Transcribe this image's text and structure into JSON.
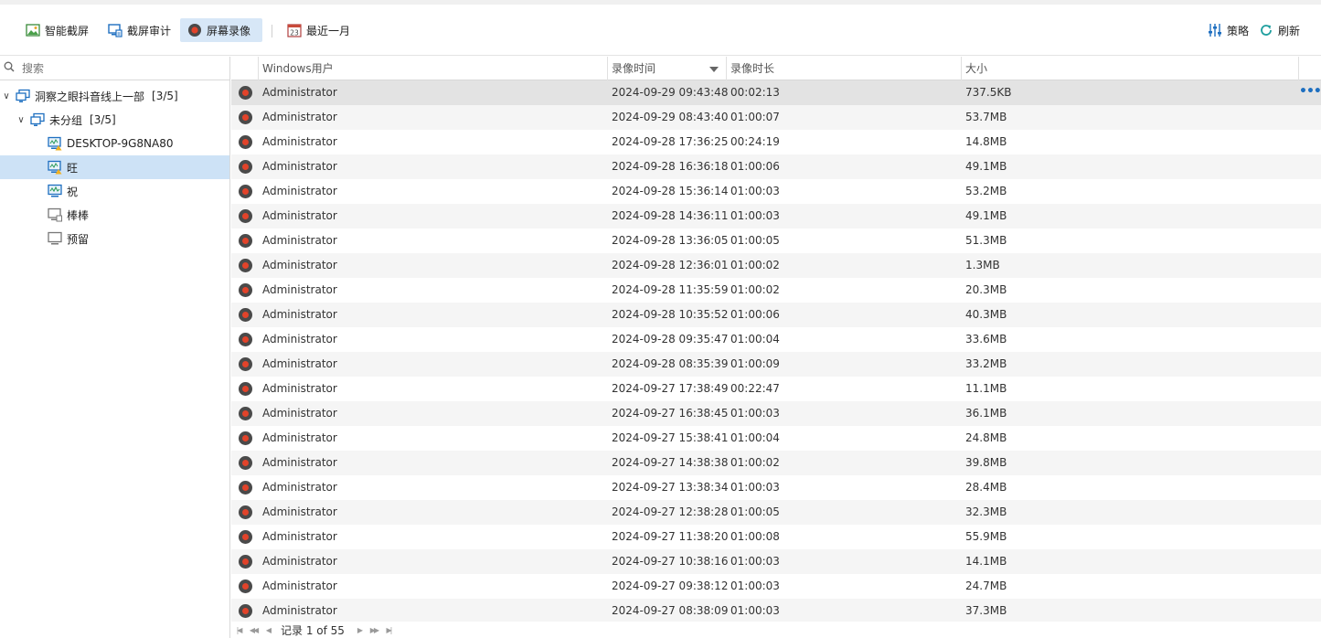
{
  "toolbar": {
    "smart_capture": "智能截屏",
    "screen_audit": "截屏审计",
    "screen_record": "屏幕录像",
    "last_month": "最近一月",
    "calendar_day": "23",
    "policy": "策略",
    "refresh": "刷新"
  },
  "search": {
    "placeholder": "搜索"
  },
  "tree": {
    "root": {
      "label": "洞察之眼抖音线上一部",
      "count": "[3/5]"
    },
    "group": {
      "label": "未分组",
      "count": "[3/5]"
    },
    "computers": [
      {
        "label": "DESKTOP-9G8NA80",
        "status": "online-warning"
      },
      {
        "label": "旺",
        "status": "online-warning"
      },
      {
        "label": "祝",
        "status": "online"
      },
      {
        "label": "棒棒",
        "status": "offline"
      },
      {
        "label": "预留",
        "status": "offline"
      }
    ]
  },
  "table": {
    "columns": [
      "Windows用户",
      "录像时间",
      "录像时长",
      "大小"
    ],
    "sorted_column": "录像时间",
    "more_label": "•••",
    "rows": [
      {
        "user": "Administrator",
        "time": "2024-09-29 09:43:48",
        "duration": "00:02:13",
        "size": "737.5KB"
      },
      {
        "user": "Administrator",
        "time": "2024-09-29 08:43:40",
        "duration": "01:00:07",
        "size": "53.7MB"
      },
      {
        "user": "Administrator",
        "time": "2024-09-28 17:36:25",
        "duration": "00:24:19",
        "size": "14.8MB"
      },
      {
        "user": "Administrator",
        "time": "2024-09-28 16:36:18",
        "duration": "01:00:06",
        "size": "49.1MB"
      },
      {
        "user": "Administrator",
        "time": "2024-09-28 15:36:14",
        "duration": "01:00:03",
        "size": "53.2MB"
      },
      {
        "user": "Administrator",
        "time": "2024-09-28 14:36:11",
        "duration": "01:00:03",
        "size": "49.1MB"
      },
      {
        "user": "Administrator",
        "time": "2024-09-28 13:36:05",
        "duration": "01:00:05",
        "size": "51.3MB"
      },
      {
        "user": "Administrator",
        "time": "2024-09-28 12:36:01",
        "duration": "01:00:02",
        "size": "1.3MB"
      },
      {
        "user": "Administrator",
        "time": "2024-09-28 11:35:59",
        "duration": "01:00:02",
        "size": "20.3MB"
      },
      {
        "user": "Administrator",
        "time": "2024-09-28 10:35:52",
        "duration": "01:00:06",
        "size": "40.3MB"
      },
      {
        "user": "Administrator",
        "time": "2024-09-28 09:35:47",
        "duration": "01:00:04",
        "size": "33.6MB"
      },
      {
        "user": "Administrator",
        "time": "2024-09-28 08:35:39",
        "duration": "01:00:09",
        "size": "33.2MB"
      },
      {
        "user": "Administrator",
        "time": "2024-09-27 17:38:49",
        "duration": "00:22:47",
        "size": "11.1MB"
      },
      {
        "user": "Administrator",
        "time": "2024-09-27 16:38:45",
        "duration": "01:00:03",
        "size": "36.1MB"
      },
      {
        "user": "Administrator",
        "time": "2024-09-27 15:38:41",
        "duration": "01:00:04",
        "size": "24.8MB"
      },
      {
        "user": "Administrator",
        "time": "2024-09-27 14:38:38",
        "duration": "01:00:02",
        "size": "39.8MB"
      },
      {
        "user": "Administrator",
        "time": "2024-09-27 13:38:34",
        "duration": "01:00:03",
        "size": "28.4MB"
      },
      {
        "user": "Administrator",
        "time": "2024-09-27 12:38:28",
        "duration": "01:00:05",
        "size": "32.3MB"
      },
      {
        "user": "Administrator",
        "time": "2024-09-27 11:38:20",
        "duration": "01:00:08",
        "size": "55.9MB"
      },
      {
        "user": "Administrator",
        "time": "2024-09-27 10:38:16",
        "duration": "01:00:03",
        "size": "14.1MB"
      },
      {
        "user": "Administrator",
        "time": "2024-09-27 09:38:12",
        "duration": "01:00:03",
        "size": "24.7MB"
      },
      {
        "user": "Administrator",
        "time": "2024-09-27 08:38:09",
        "duration": "01:00:03",
        "size": "37.3MB"
      }
    ]
  },
  "pager": {
    "text": "记录 1 of 55"
  },
  "colors": {
    "accent": "#1e6fc0",
    "record_red": "#e2432a",
    "selected_tree": "#cde2f6",
    "active_tool": "#d7e7f7"
  }
}
